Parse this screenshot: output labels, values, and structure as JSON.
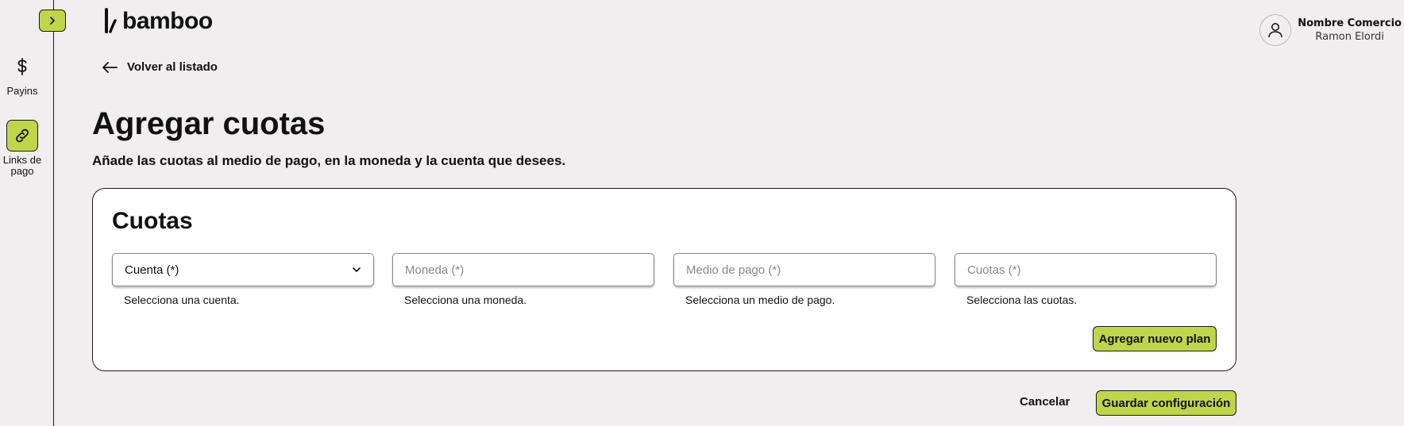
{
  "sidebar": {
    "toggle_icon": "chevron-right-icon",
    "items": [
      {
        "label": "Payins",
        "icon": "dollar-icon",
        "active": false
      },
      {
        "label": "Links de pago",
        "icon": "link-icon",
        "active": true
      }
    ]
  },
  "header": {
    "logo_text": "bamboo",
    "user_name": "Nombre Comercio",
    "user_sub": "Ramon Elordi"
  },
  "back_link": "Volver al listado",
  "page": {
    "title": "Agregar cuotas",
    "subtitle": "Añade las cuotas al medio de pago, en la moneda y la cuenta que desees."
  },
  "card": {
    "title": "Cuotas",
    "fields": [
      {
        "placeholder": "Cuenta (*)",
        "hint": "Selecciona una cuenta."
      },
      {
        "placeholder": "Moneda (*)",
        "hint": "Selecciona una moneda."
      },
      {
        "placeholder": "Medio de pago (*)",
        "hint": "Selecciona un medio de pago."
      },
      {
        "placeholder": "Cuotas (*)",
        "hint": "Selecciona las cuotas."
      }
    ],
    "add_plan_label": "Agregar nuevo plan"
  },
  "footer": {
    "cancel_label": "Cancelar",
    "save_label": "Guardar configuración"
  },
  "colors": {
    "accent": "#bfd64a",
    "background": "#f0eeef",
    "border": "#1a1a1a"
  }
}
